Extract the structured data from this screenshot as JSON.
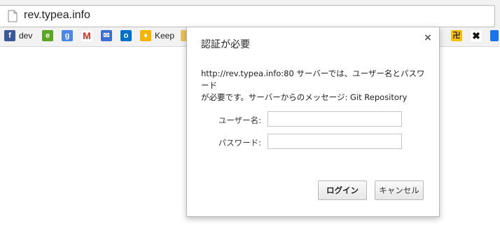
{
  "browser": {
    "url": "rev.typea.info",
    "bookmarks": [
      {
        "label": "dev",
        "icon": "facebook-icon",
        "color": "#3b5998"
      },
      {
        "label": "",
        "icon": "evernote-icon",
        "color": "#5ba525"
      },
      {
        "label": "",
        "icon": "google-icon",
        "color": "#4a86e8"
      },
      {
        "label": "",
        "icon": "gmail-icon",
        "color": "#d93025"
      },
      {
        "label": "",
        "icon": "inbox-icon",
        "color": "#3b6fd4"
      },
      {
        "label": "",
        "icon": "outlook-icon",
        "color": "#0072c6"
      },
      {
        "label": "Keep",
        "icon": "keep-icon",
        "color": "#f4b400"
      }
    ],
    "right_bookmarks": [
      {
        "icon": "app-icon",
        "color": "#f4c20d"
      },
      {
        "icon": "puzzle-icon",
        "color": "#111111"
      },
      {
        "icon": "blue-square-icon",
        "color": "#1a73e8"
      }
    ]
  },
  "dialog": {
    "title": "認証が必要",
    "close_glyph": "×",
    "message_line1": "http://rev.typea.info:80 サーバーでは、ユーザー名とパスワード",
    "message_line2": "が必要です。サーバーからのメッセージ: Git Repository",
    "username_label": "ユーザー名:",
    "username_value": "",
    "password_label": "パスワード:",
    "password_value": "",
    "login_label": "ログイン",
    "cancel_label": "キャンセル"
  }
}
